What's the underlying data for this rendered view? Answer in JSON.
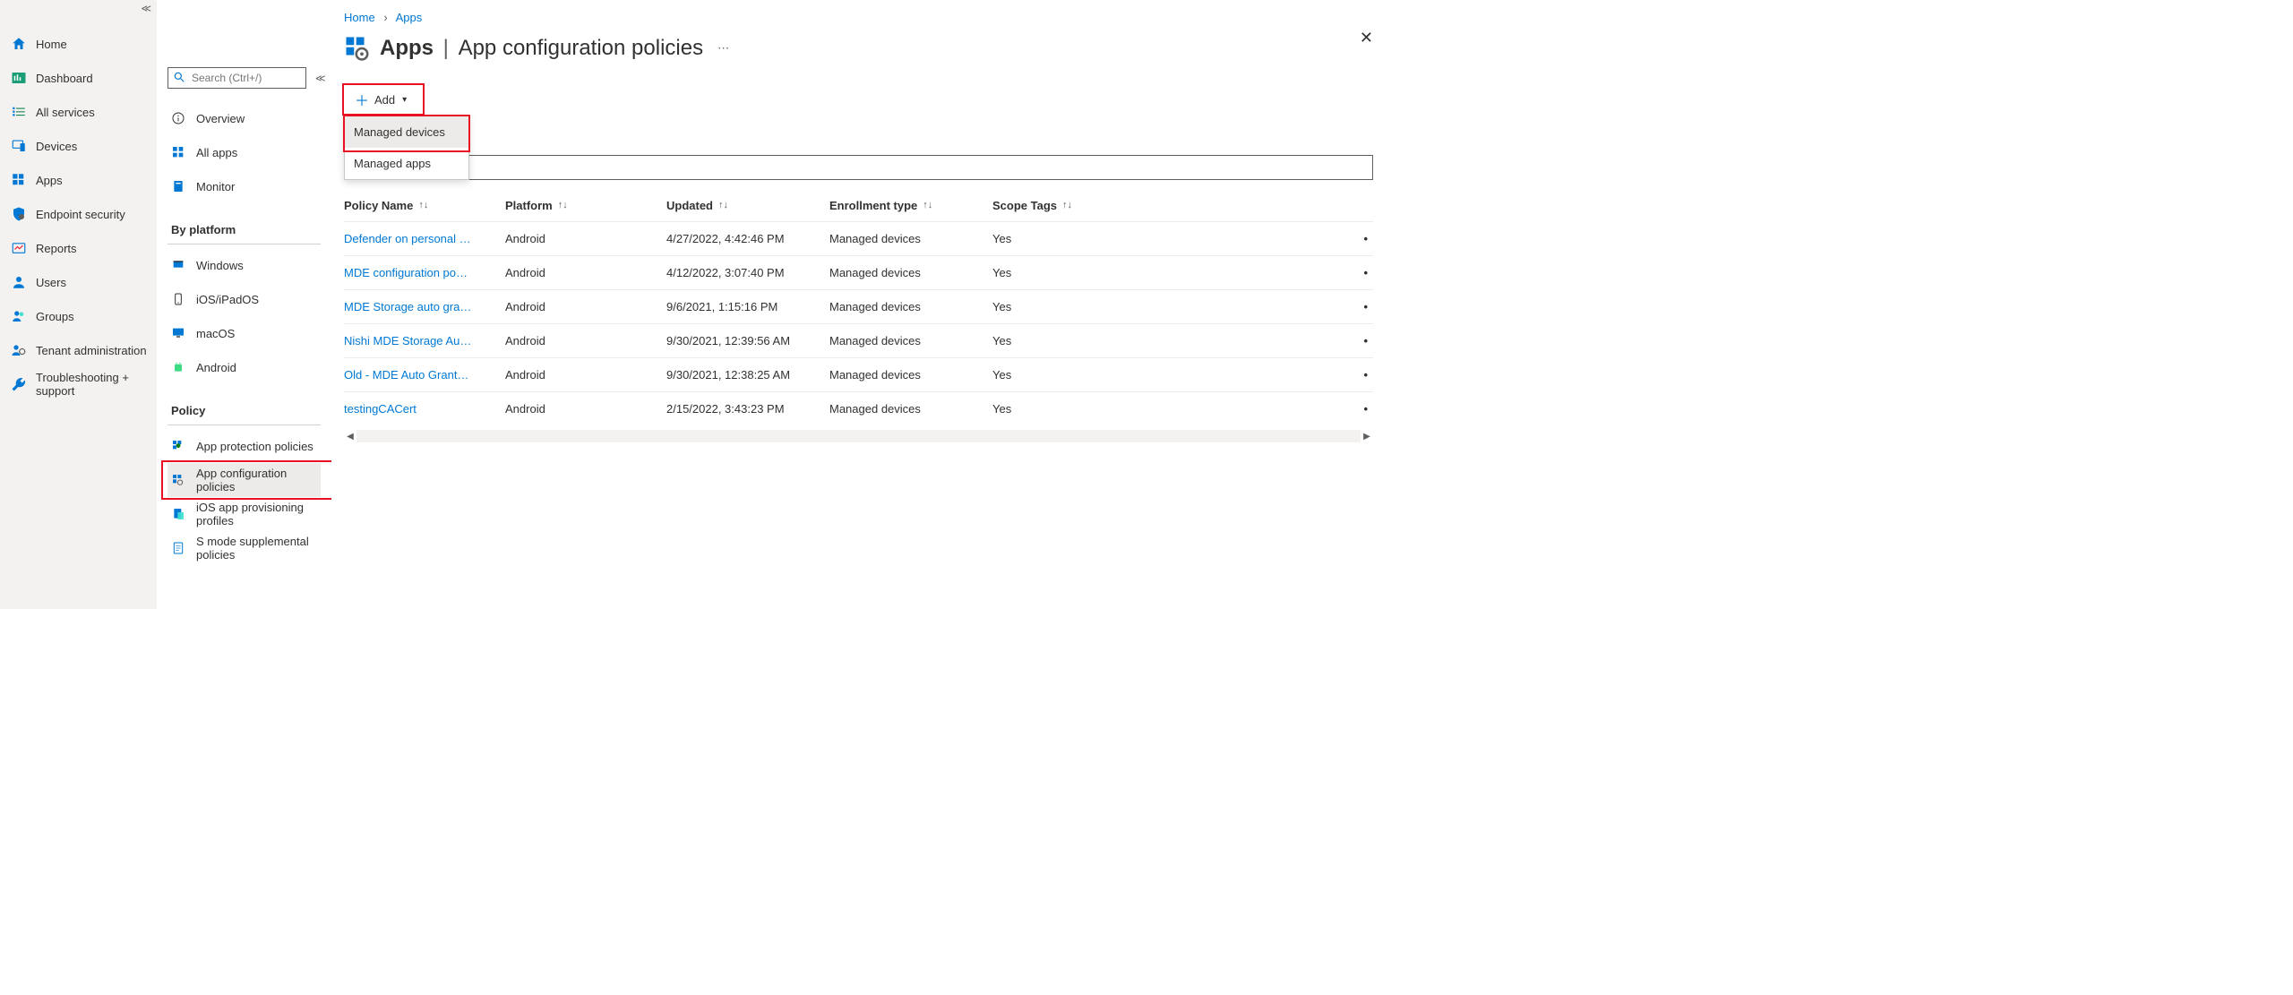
{
  "breadcrumb": {
    "home": "Home",
    "apps": "Apps"
  },
  "title": {
    "apps": "Apps",
    "sep": "|",
    "rest": "App configuration policies"
  },
  "leftnav": [
    {
      "label": "Home"
    },
    {
      "label": "Dashboard"
    },
    {
      "label": "All services"
    },
    {
      "label": "Devices"
    },
    {
      "label": "Apps"
    },
    {
      "label": "Endpoint security"
    },
    {
      "label": "Reports"
    },
    {
      "label": "Users"
    },
    {
      "label": "Groups"
    },
    {
      "label": "Tenant administration"
    },
    {
      "label": "Troubleshooting + support"
    }
  ],
  "subnav": {
    "searchPlaceholder": "Search (Ctrl+/)",
    "items1": [
      {
        "label": "Overview"
      },
      {
        "label": "All apps"
      },
      {
        "label": "Monitor"
      }
    ],
    "platformHeading": "By platform",
    "platforms": [
      {
        "label": "Windows"
      },
      {
        "label": "iOS/iPadOS"
      },
      {
        "label": "macOS"
      },
      {
        "label": "Android"
      }
    ],
    "policyHeading": "Policy",
    "policies": [
      {
        "label": "App protection policies"
      },
      {
        "label": "App configuration policies"
      },
      {
        "label": "iOS app provisioning profiles"
      },
      {
        "label": "S mode supplemental policies"
      }
    ]
  },
  "toolbar": {
    "add": "Add"
  },
  "dropdown": {
    "o1": "Managed devices",
    "o2": "Managed apps"
  },
  "columns": {
    "name": "Policy Name",
    "platform": "Platform",
    "updated": "Updated",
    "enroll": "Enrollment type",
    "scope": "Scope Tags"
  },
  "rows": [
    {
      "name": "Defender on personal …",
      "platform": "Android",
      "updated": "4/27/2022, 4:42:46 PM",
      "enroll": "Managed devices",
      "scope": "Yes"
    },
    {
      "name": "MDE configuration po…",
      "platform": "Android",
      "updated": "4/12/2022, 3:07:40 PM",
      "enroll": "Managed devices",
      "scope": "Yes"
    },
    {
      "name": "MDE Storage auto gra…",
      "platform": "Android",
      "updated": "9/6/2021, 1:15:16 PM",
      "enroll": "Managed devices",
      "scope": "Yes"
    },
    {
      "name": "Nishi MDE Storage Au…",
      "platform": "Android",
      "updated": "9/30/2021, 12:39:56 AM",
      "enroll": "Managed devices",
      "scope": "Yes"
    },
    {
      "name": "Old - MDE Auto Grant…",
      "platform": "Android",
      "updated": "9/30/2021, 12:38:25 AM",
      "enroll": "Managed devices",
      "scope": "Yes"
    },
    {
      "name": "testingCACert",
      "platform": "Android",
      "updated": "2/15/2022, 3:43:23 PM",
      "enroll": "Managed devices",
      "scope": "Yes"
    }
  ]
}
